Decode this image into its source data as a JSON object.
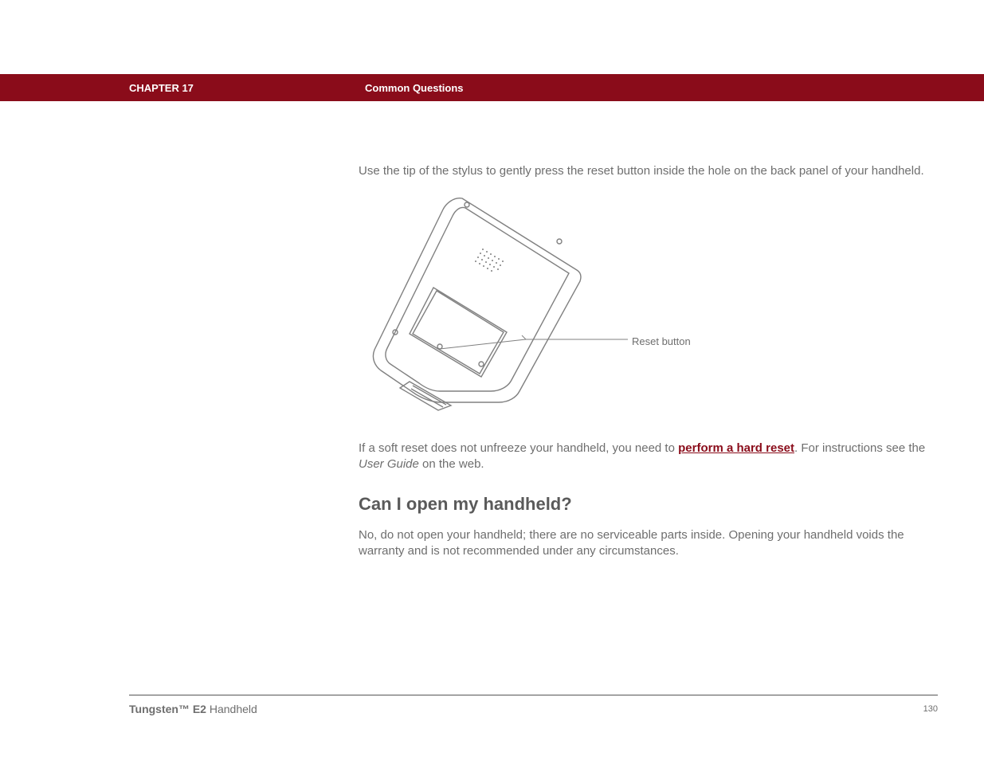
{
  "header": {
    "chapter": "CHAPTER 17",
    "title": "Common Questions"
  },
  "body": {
    "para1": "Use the tip of the stylus to gently press the reset button inside the hole on the back panel of your handheld.",
    "figure": {
      "callout": "Reset button"
    },
    "para2_pre": "If a soft reset does not unfreeze your handheld, you need to ",
    "para2_link": "perform a hard reset",
    "para2_post1": ". For instructions see the ",
    "para2_italic": "User Guide",
    "para2_post2": " on the web.",
    "section_heading": "Can I open my handheld?",
    "para3": "No, do not open your handheld; there are no serviceable parts inside. Opening your handheld voids the warranty and is not recommended under any circumstances."
  },
  "footer": {
    "product_bold": "Tungsten™ E2",
    "product_rest": " Handheld",
    "page_number": "130"
  }
}
